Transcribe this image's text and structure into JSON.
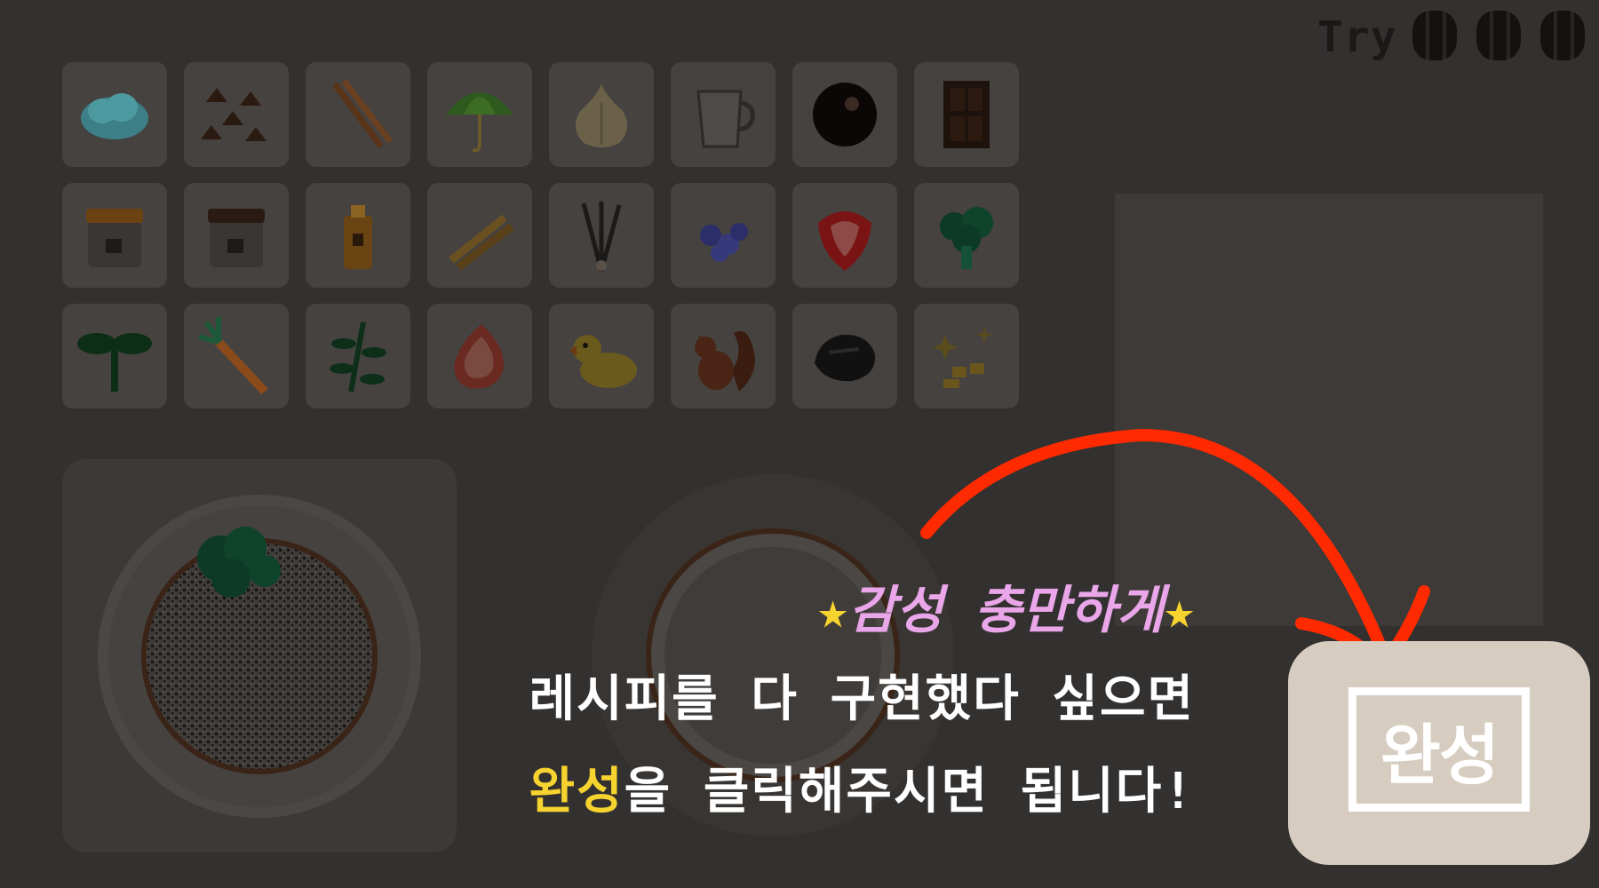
{
  "hud": {
    "try_label": "Try",
    "tries_remaining": 3
  },
  "ingredients": [
    "blue-cloud",
    "chocolate-chips",
    "cinnamon-sticks",
    "green-umbrella",
    "garlic",
    "milk-pitcher",
    "dark-ball",
    "chocolate-bar",
    "jar-brown",
    "jar-dark",
    "syrup-bottle",
    "biscuit-sticks",
    "vanilla-sprigs",
    "blueberries",
    "strawberry",
    "broccoli",
    "sprout",
    "carrot",
    "herb-branch",
    "ham",
    "rubber-duck",
    "squirrel",
    "dark-rock",
    "gold-sparkles"
  ],
  "tutorial": {
    "line1_star_left": "★",
    "line1_text": "감성 충만하게",
    "line1_star_right": "★",
    "line2": "레시피를 다 구현했다 싶으면",
    "line3_highlight": "완성",
    "line3_rest": "을 클릭해주시면 됩니다!"
  },
  "done_button": {
    "label": "완성"
  },
  "colors": {
    "background": "#333030",
    "slot": "#454240",
    "button": "#d7ccc0",
    "arrow": "#ff2a00",
    "highlight": "#f6d32f",
    "pink": "#e9a6e8"
  }
}
